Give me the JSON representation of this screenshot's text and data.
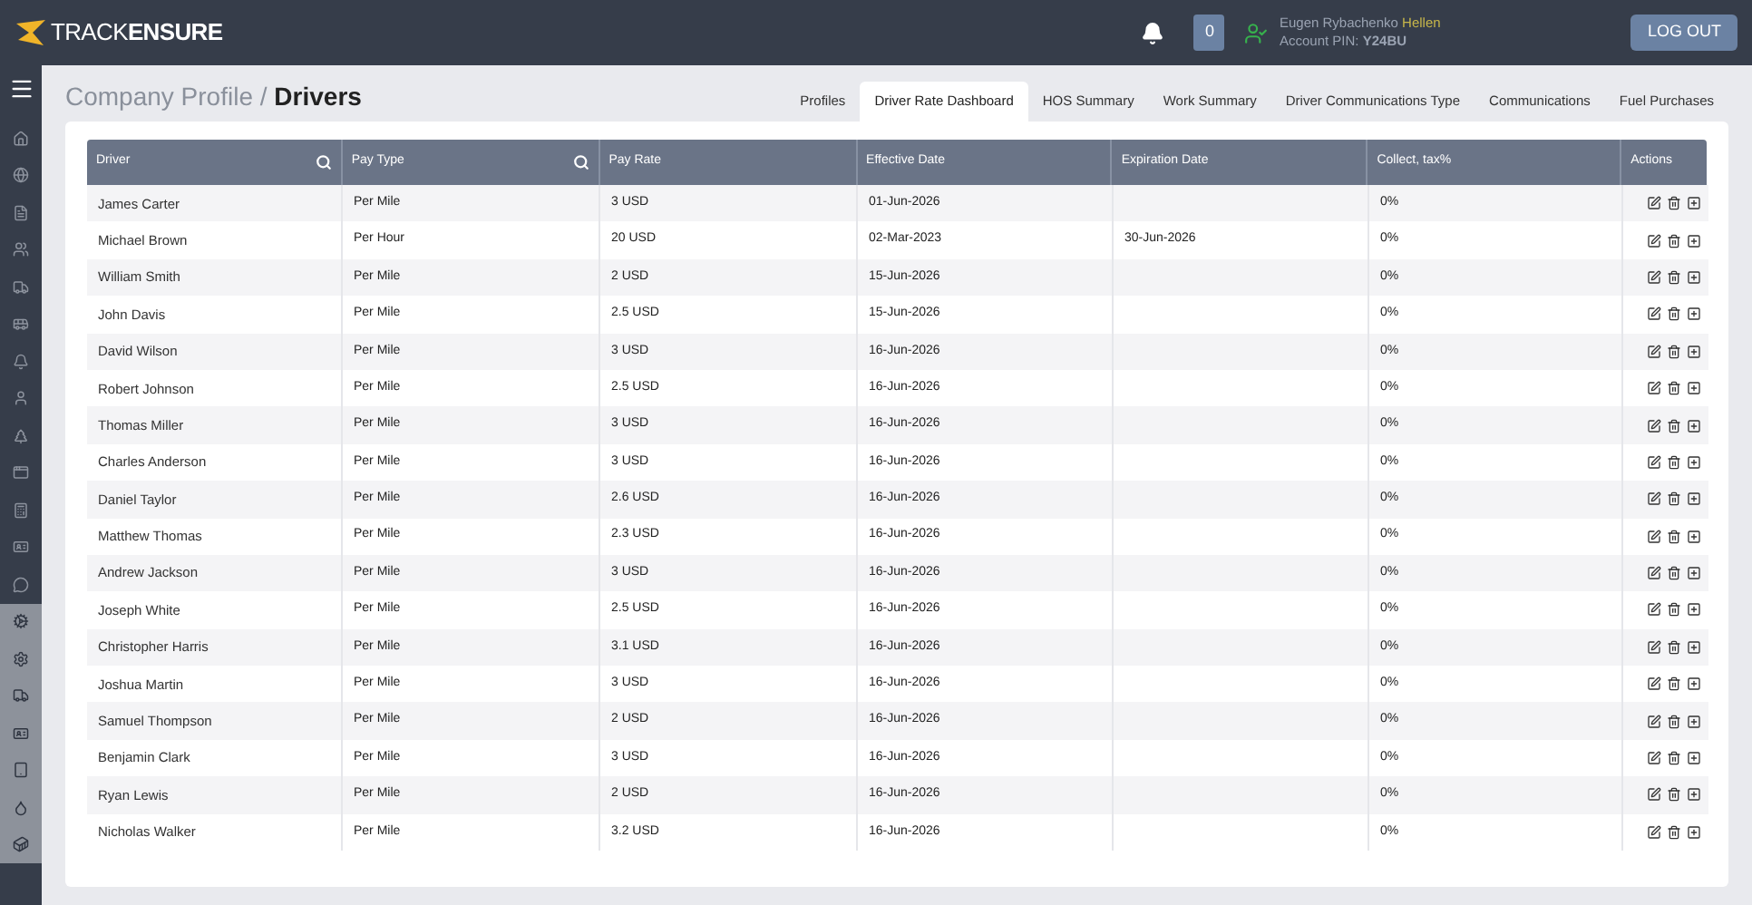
{
  "header": {
    "brand_prefix": "TRACK",
    "brand_suffix": "ENSURE",
    "notification_count": "0",
    "user_name": "Eugen Rybachenko",
    "user_role": "Hellen",
    "account_label": "Account PIN:",
    "account_pin": "Y24BU",
    "logout": "LOG OUT"
  },
  "sidebar": {
    "items": [
      {
        "kind": "primary"
      },
      {
        "kind": "primary"
      },
      {
        "kind": "primary"
      },
      {
        "kind": "primary"
      },
      {
        "kind": "primary"
      },
      {
        "kind": "primary"
      },
      {
        "kind": "primary"
      },
      {
        "kind": "primary"
      },
      {
        "kind": "primary"
      },
      {
        "kind": "primary"
      },
      {
        "kind": "primary"
      },
      {
        "kind": "primary"
      },
      {
        "kind": "primary"
      },
      {
        "kind": "secondary"
      },
      {
        "kind": "secondary"
      },
      {
        "kind": "secondary"
      },
      {
        "kind": "secondary"
      },
      {
        "kind": "secondary"
      },
      {
        "kind": "secondary"
      },
      {
        "kind": "secondary"
      }
    ]
  },
  "breadcrumb": {
    "parent": "Company Profile /",
    "current": "Drivers"
  },
  "tabs": [
    {
      "label": "Profiles",
      "selected": false
    },
    {
      "label": "Driver Rate Dashboard",
      "selected": true
    },
    {
      "label": "HOS Summary",
      "selected": false
    },
    {
      "label": "Work Summary",
      "selected": false
    },
    {
      "label": "Driver Communications Type",
      "selected": false
    },
    {
      "label": "Communications",
      "selected": false
    },
    {
      "label": "Fuel Purchases",
      "selected": false
    }
  ],
  "table": {
    "columns": [
      {
        "label": "Driver",
        "searchable": true
      },
      {
        "label": "Pay Type",
        "searchable": true
      },
      {
        "label": "Pay Rate",
        "searchable": false
      },
      {
        "label": "Effective Date",
        "searchable": false
      },
      {
        "label": "Expiration Date",
        "searchable": false
      },
      {
        "label": "Collect, tax%",
        "searchable": false
      },
      {
        "label": "Actions",
        "searchable": false
      }
    ],
    "rows": [
      [
        "James Carter",
        "Per Mile",
        "3 USD",
        "01-Jun-2026",
        "",
        "0%"
      ],
      [
        "Michael Brown",
        "Per Hour",
        "20 USD",
        "02-Mar-2023",
        "30-Jun-2026",
        "0%"
      ],
      [
        "William Smith",
        "Per Mile",
        "2 USD",
        "15-Jun-2026",
        "",
        "0%"
      ],
      [
        "John Davis",
        "Per Mile",
        "2.5 USD",
        "15-Jun-2026",
        "",
        "0%"
      ],
      [
        "David Wilson",
        "Per Mile",
        "3 USD",
        "16-Jun-2026",
        "",
        "0%"
      ],
      [
        "Robert Johnson",
        "Per Mile",
        "2.5 USD",
        "16-Jun-2026",
        "",
        "0%"
      ],
      [
        "Thomas Miller",
        "Per Mile",
        "3 USD",
        "16-Jun-2026",
        "",
        "0%"
      ],
      [
        "Charles Anderson",
        "Per Mile",
        "3 USD",
        "16-Jun-2026",
        "",
        "0%"
      ],
      [
        "Daniel Taylor",
        "Per Mile",
        "2.6 USD",
        "16-Jun-2026",
        "",
        "0%"
      ],
      [
        "Matthew Thomas",
        "Per Mile",
        "2.3 USD",
        "16-Jun-2026",
        "",
        "0%"
      ],
      [
        "Andrew Jackson",
        "Per Mile",
        "3 USD",
        "16-Jun-2026",
        "",
        "0%"
      ],
      [
        "Joseph White",
        "Per Mile",
        "2.5 USD",
        "16-Jun-2026",
        "",
        "0%"
      ],
      [
        "Christopher Harris",
        "Per Mile",
        "3.1 USD",
        "16-Jun-2026",
        "",
        "0%"
      ],
      [
        "Joshua Martin",
        "Per Mile",
        "3 USD",
        "16-Jun-2026",
        "",
        "0%"
      ],
      [
        "Samuel Thompson",
        "Per Mile",
        "2 USD",
        "16-Jun-2026",
        "",
        "0%"
      ],
      [
        "Benjamin Clark",
        "Per Mile",
        "3 USD",
        "16-Jun-2026",
        "",
        "0%"
      ],
      [
        "Ryan Lewis",
        "Per Mile",
        "2 USD",
        "16-Jun-2026",
        "",
        "0%"
      ],
      [
        "Nicholas Walker",
        "Per Mile",
        "3.2 USD",
        "16-Jun-2026",
        "",
        "0%"
      ]
    ]
  }
}
